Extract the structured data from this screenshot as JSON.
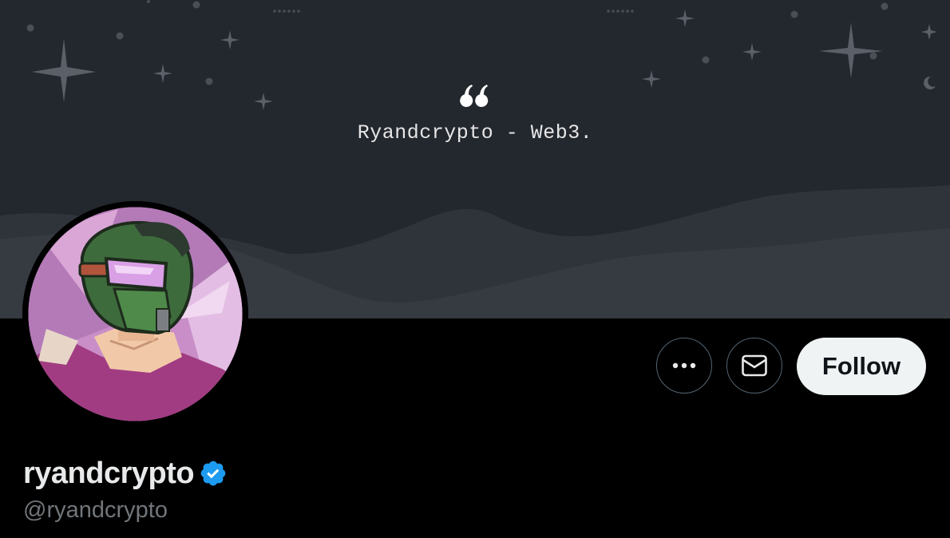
{
  "banner": {
    "quote_text": "Ryandcrypto - Web3.",
    "background_color": "#23272e",
    "quote_icon": "quote-icon"
  },
  "avatar": {
    "description_icon": "avatar-image",
    "ring_color": "#000000"
  },
  "actions": {
    "more_icon": "more-horizontal-icon",
    "message_icon": "envelope-icon",
    "follow_label": "Follow"
  },
  "profile": {
    "display_name": "ryandcrypto",
    "verified_icon": "verified-badge-icon",
    "verified_color": "#1d9bf0",
    "handle": "@ryandcrypto"
  }
}
